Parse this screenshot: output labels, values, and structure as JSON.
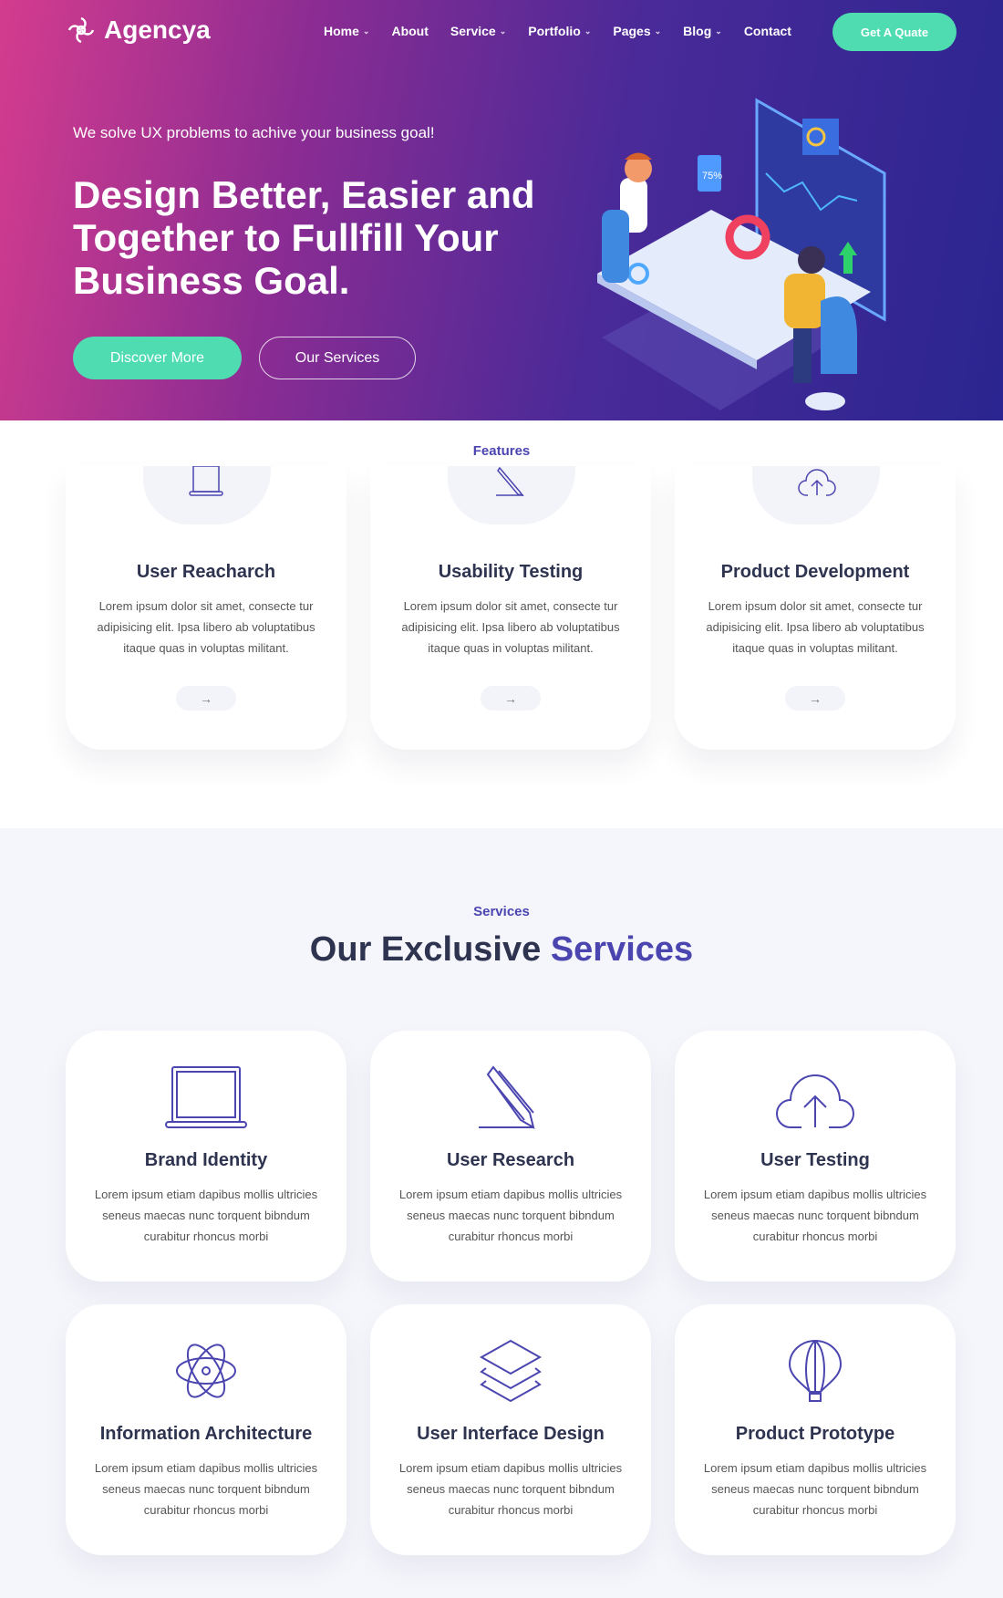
{
  "colors": {
    "accent": "#4b45b0",
    "cta": "#4fdcb0",
    "heading": "#2e3350"
  },
  "header": {
    "logo": "Agencya",
    "nav": [
      {
        "label": "Home",
        "dropdown": true
      },
      {
        "label": "About",
        "dropdown": false
      },
      {
        "label": "Service",
        "dropdown": true
      },
      {
        "label": "Portfolio",
        "dropdown": true
      },
      {
        "label": "Pages",
        "dropdown": true
      },
      {
        "label": "Blog",
        "dropdown": true
      },
      {
        "label": "Contact",
        "dropdown": false
      }
    ],
    "cta": "Get A Quate"
  },
  "hero": {
    "tagline": "We solve UX problems to achive your business goal!",
    "headline": "Design Better, Easier and Together to Fullfill Your Business Goal.",
    "primary_button": "Discover More",
    "secondary_button": "Our Services",
    "illustration_badge": "75%"
  },
  "features": {
    "label": "Features",
    "cards": [
      {
        "icon": "laptop-icon",
        "title": "User Reacharch",
        "text": "Lorem ipsum dolor sit amet, consecte tur adipisicing elit. Ipsa libero ab voluptatibus itaque quas in voluptas militant."
      },
      {
        "icon": "pencil-icon",
        "title": "Usability Testing",
        "text": "Lorem ipsum dolor sit amet, consecte tur adipisicing elit. Ipsa libero ab voluptatibus itaque quas in voluptas militant."
      },
      {
        "icon": "cloud-upload-icon",
        "title": "Product Development",
        "text": "Lorem ipsum dolor sit amet, consecte tur adipisicing elit. Ipsa libero ab voluptatibus itaque quas in voluptas militant."
      }
    ],
    "arrow": "→"
  },
  "services": {
    "label": "Services",
    "title_main": "Our Exclusive ",
    "title_accent": "Services",
    "cards": [
      {
        "icon": "laptop-icon",
        "title": "Brand Identity",
        "text": "Lorem ipsum etiam dapibus mollis ultricies seneus maecas nunc torquent bibndum curabitur rhoncus morbi"
      },
      {
        "icon": "pencil-icon",
        "title": "User Research",
        "text": "Lorem ipsum etiam dapibus mollis ultricies seneus maecas nunc torquent bibndum curabitur rhoncus morbi"
      },
      {
        "icon": "cloud-upload-icon",
        "title": "User Testing",
        "text": "Lorem ipsum etiam dapibus mollis ultricies seneus maecas nunc torquent bibndum curabitur rhoncus morbi"
      },
      {
        "icon": "atom-icon",
        "title": "Information Architecture",
        "text": "Lorem ipsum etiam dapibus mollis ultricies seneus maecas nunc torquent bibndum curabitur rhoncus morbi"
      },
      {
        "icon": "layers-icon",
        "title": "User Interface Design",
        "text": "Lorem ipsum etiam dapibus mollis ultricies seneus maecas nunc torquent bibndum curabitur rhoncus morbi"
      },
      {
        "icon": "balloon-icon",
        "title": "Product Prototype",
        "text": "Lorem ipsum etiam dapibus mollis ultricies seneus maecas nunc torquent bibndum curabitur rhoncus morbi"
      }
    ]
  }
}
